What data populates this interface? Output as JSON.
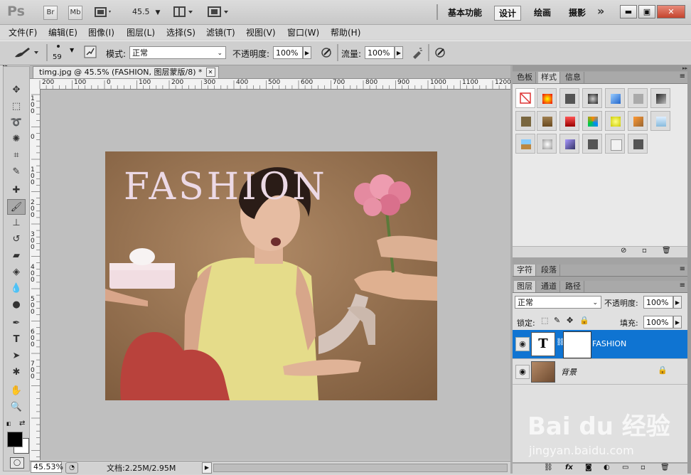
{
  "app": {
    "logo": "Ps",
    "bridge_label": "Br",
    "minibridge_label": "Mb",
    "zoom_level": "45.5",
    "workspaces": [
      "基本功能",
      "设计",
      "绘画",
      "摄影"
    ],
    "active_workspace": "设计",
    "more": "»"
  },
  "menu": [
    "文件(F)",
    "编辑(E)",
    "图像(I)",
    "图层(L)",
    "选择(S)",
    "滤镜(T)",
    "视图(V)",
    "窗口(W)",
    "帮助(H)"
  ],
  "options": {
    "brush_size": "59",
    "mode_label": "模式:",
    "mode_value": "正常",
    "opacity_label": "不透明度:",
    "opacity_value": "100%",
    "flow_label": "流量:",
    "flow_value": "100%"
  },
  "document": {
    "tab_title": "timg.jpg @ 45.5% (FASHION, 图层蒙版/8) *",
    "ruler_h": [
      "200",
      "100",
      "0",
      "100",
      "200",
      "300",
      "400",
      "500",
      "600",
      "700",
      "800",
      "900",
      "1000",
      "1100",
      "1200"
    ],
    "ruler_v": [
      "100",
      "0",
      "100",
      "200",
      "300",
      "400",
      "500",
      "600",
      "700"
    ],
    "fashion_text": "FASHION"
  },
  "status": {
    "zoom": "45.53%",
    "doc_info": "文档:2.25M/2.95M"
  },
  "panels": {
    "top_tabs": [
      "色板",
      "样式",
      "信息"
    ],
    "active_top": "样式",
    "mid_tabs": [
      "字符",
      "段落"
    ],
    "layer_tabs": [
      "图层",
      "通道",
      "路径"
    ],
    "active_layer_tab": "图层",
    "blend_mode": "正常",
    "opacity_label": "不透明度:",
    "opacity_value": "100%",
    "lock_label": "锁定:",
    "fill_label": "填充:",
    "fill_value": "100%",
    "layers": [
      {
        "name": "FASHION",
        "type": "text",
        "selected": true
      },
      {
        "name": "背景",
        "type": "image",
        "selected": false
      }
    ]
  },
  "watermark": {
    "brand": "Bai du 经验",
    "url": "jingyan.baidu.com"
  }
}
